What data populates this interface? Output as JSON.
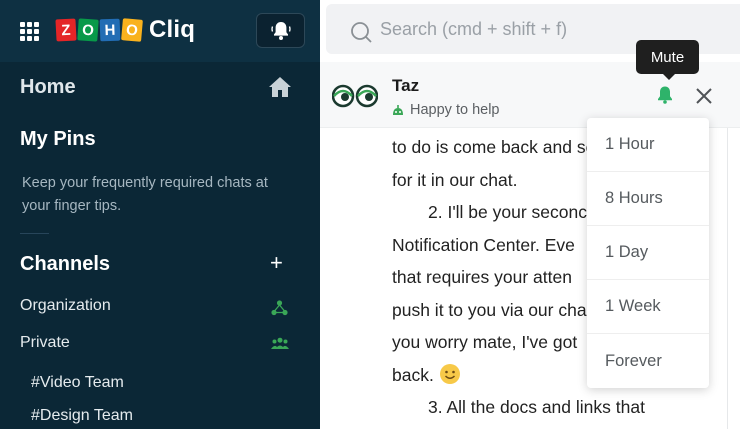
{
  "app": {
    "logo_letters": [
      "Z",
      "O",
      "H",
      "O"
    ],
    "logo_colors": [
      "#e42527",
      "#089949",
      "#226db4",
      "#f9b21d"
    ],
    "logo_word": "Cliq"
  },
  "sidebar": {
    "home_label": "Home",
    "pins_title": "My Pins",
    "pins_desc_line1": "Keep your frequently required chats at",
    "pins_desc_line2": "your finger tips.",
    "channels_title": "Channels",
    "items": [
      {
        "label": "Organization",
        "icon": "organization-icon"
      },
      {
        "label": "Private",
        "icon": "people-group-icon"
      }
    ],
    "channels": [
      "#Video Team",
      "#Design Team"
    ]
  },
  "search": {
    "placeholder": "Search (cmd + shift + f)"
  },
  "chat": {
    "bot_name": "Taz",
    "bot_status": "Happy to help",
    "status_color": "#3aa757",
    "message_lines": [
      "to do is come back and se",
      "for it in our chat.",
      "2. I'll be your seconc",
      "Notification Center. Eve",
      "that requires your atten",
      "push it to you via our cha",
      "you worry mate, I've got",
      "back.",
      "3. All the docs and links that"
    ]
  },
  "tooltip": {
    "label": "Mute"
  },
  "mute_options": [
    "1 Hour",
    "8 Hours",
    "1 Day",
    "1 Week",
    "Forever"
  ],
  "colors": {
    "accent_green": "#3aa757",
    "sidebar_bg": "#0b2736"
  }
}
